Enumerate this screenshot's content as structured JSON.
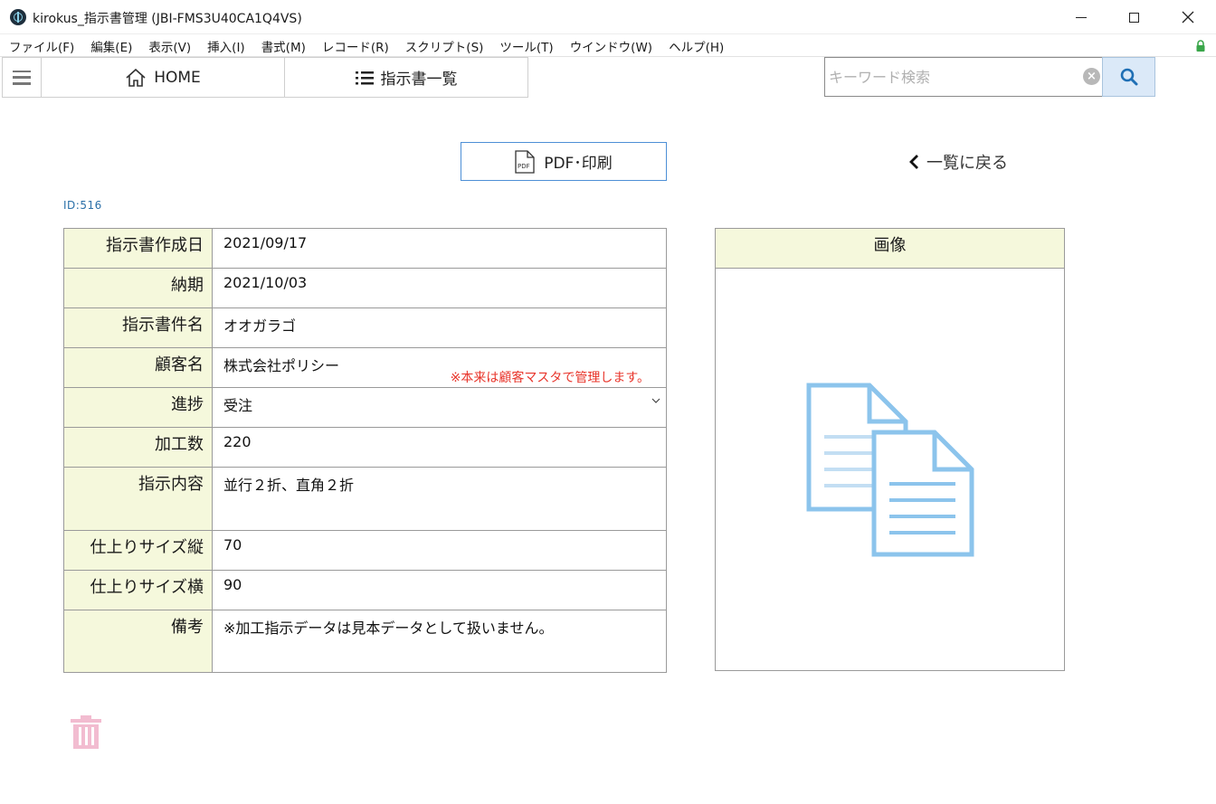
{
  "window": {
    "title": "kirokus_指示書管理 (JBI-FMS3U40CA1Q4VS)",
    "minimize": "—",
    "maximize": "□",
    "close": "✕"
  },
  "menu": [
    "ファイル(F)",
    "編集(E)",
    "表示(V)",
    "挿入(I)",
    "書式(M)",
    "レコード(R)",
    "スクリプト(S)",
    "ツール(T)",
    "ウインドウ(W)",
    "ヘルプ(H)"
  ],
  "toolbar": {
    "home_label": "HOME",
    "list_label": "指示書一覧",
    "search_placeholder": "キーワード検索",
    "search_value": ""
  },
  "actions": {
    "pdf_label": "PDF･印刷",
    "back_label": "一覧に戻る"
  },
  "record": {
    "id_label": "ID:516"
  },
  "fields": [
    {
      "label": "指示書作成日",
      "value": "2021/09/17"
    },
    {
      "label": "納期",
      "value": "2021/10/03"
    },
    {
      "label": "指示書件名",
      "value": "オオガラゴ"
    },
    {
      "label": "顧客名",
      "value": "株式会社ポリシー",
      "note": "※本来は顧客マスタで管理します。"
    },
    {
      "label": "進捗",
      "value": "受注"
    },
    {
      "label": "加工数",
      "value": "220"
    },
    {
      "label": "指示内容",
      "value": "並行２折、直角２折"
    },
    {
      "label": "仕上りサイズ縦",
      "value": "70"
    },
    {
      "label": "仕上りサイズ横",
      "value": "90"
    },
    {
      "label": "備考",
      "value": "※加工指示データは見本データとして扱いません。"
    }
  ],
  "image_panel": {
    "header": "画像",
    "icon": "documents-icon"
  },
  "colors": {
    "label_bg": "#f5f8dc",
    "accent_blue": "#4d8fd6",
    "note_red": "#e8342a",
    "doc_icon": "#8cc4ec",
    "trash": "#f2bcd0"
  }
}
